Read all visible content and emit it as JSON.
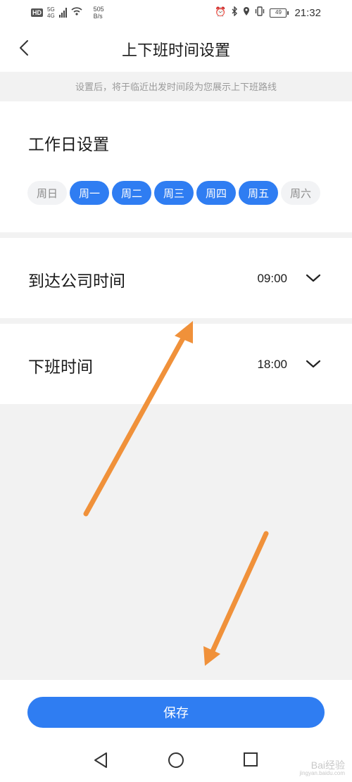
{
  "status_bar": {
    "hd": "HD",
    "network": "5G",
    "network_sub": "4G",
    "speed_value": "505",
    "speed_unit": "B/s",
    "battery": "49",
    "time": "21:32",
    "icons": [
      "alarm-icon",
      "bluetooth-icon",
      "location-icon",
      "vibrate-icon",
      "battery-icon"
    ]
  },
  "header": {
    "title": "上下班时间设置"
  },
  "hint": "设置后，将于临近出发时间段为您展示上下班路线",
  "workday": {
    "title": "工作日设置",
    "days": [
      {
        "label": "周日",
        "selected": false
      },
      {
        "label": "周一",
        "selected": true
      },
      {
        "label": "周二",
        "selected": true
      },
      {
        "label": "周三",
        "selected": true
      },
      {
        "label": "周四",
        "selected": true
      },
      {
        "label": "周五",
        "selected": true
      },
      {
        "label": "周六",
        "selected": false
      }
    ]
  },
  "arrive": {
    "label": "到达公司时间",
    "value": "09:00"
  },
  "leave": {
    "label": "下班时间",
    "value": "18:00"
  },
  "save_label": "保存",
  "watermark": {
    "text": "Bai经验",
    "sub": "jingyan.baidu.com"
  },
  "colors": {
    "accent": "#2f7df2",
    "annotation_arrow": "#f0913a"
  }
}
